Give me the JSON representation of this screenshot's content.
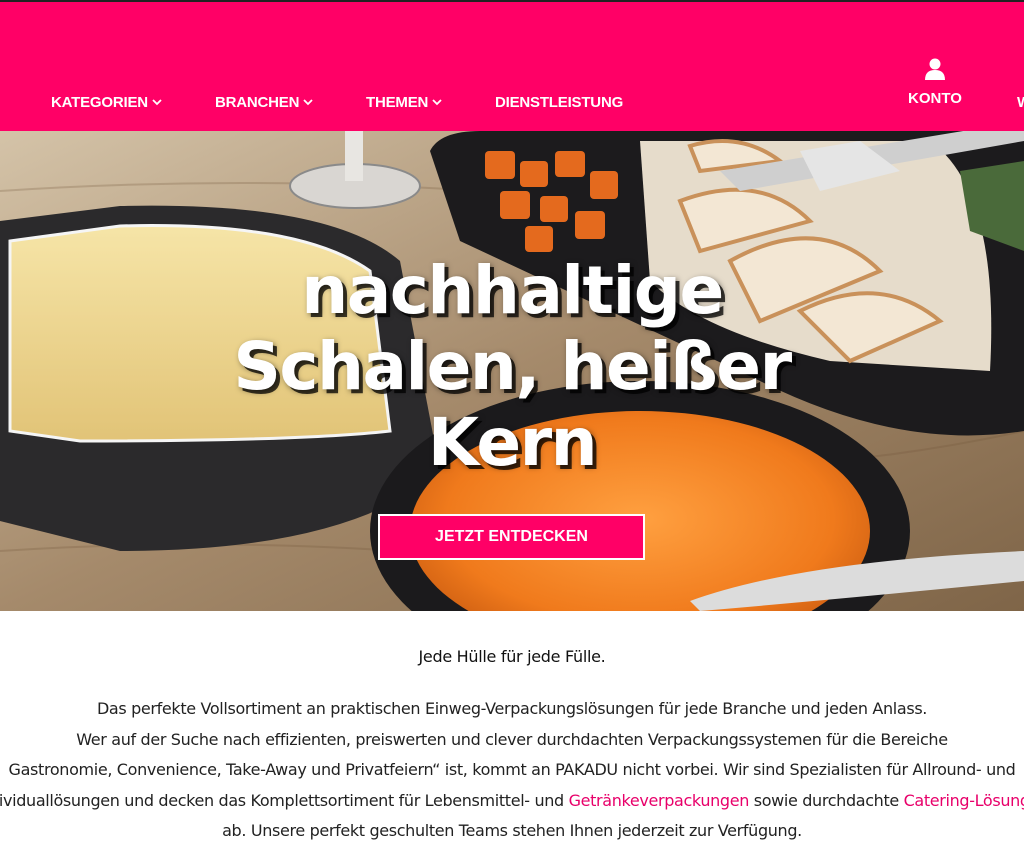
{
  "header": {
    "nav": [
      {
        "label": "KATEGORIEN",
        "has_dropdown": true
      },
      {
        "label": "BRANCHEN",
        "has_dropdown": true
      },
      {
        "label": "THEMEN",
        "has_dropdown": true
      },
      {
        "label": "DIENSTLEISTUNG",
        "has_dropdown": false
      }
    ],
    "account": {
      "label": "KONTO",
      "icon": "user-icon"
    },
    "cut_item": "W",
    "brand_color": "#ff0066"
  },
  "hero": {
    "title_lines": [
      "nachhaltige",
      "Schalen, heißer",
      "Kern"
    ],
    "cta_label": "JETZT ENTDECKEN"
  },
  "content": {
    "tagline": "Jede Hülle für jede Fülle.",
    "paragraph": {
      "line1": "Das perfekte Vollsortiment an praktischen Einweg-Verpackungslösungen für jede Branche und jeden Anlass.",
      "line2": "Wer auf der Suche nach effizienten, preiswerten und clever durchdachten Verpackungssystemen für die Bereiche",
      "line3": "Gastronomie, Convenience, Take-Away und Privatfeiern“ ist, kommt an PAKADU nicht vorbei. Wir sind Spezialisten für Allround- und",
      "line4_before": "Individuallösungen und decken das Komplettsortiment für Lebensmittel- und ",
      "link1": "Getränkeverpackungen",
      "line4_middle": " sowie durchdachte ",
      "link2": "Catering-Lösungen",
      "line5": "ab. Unsere perfekt geschulten Teams stehen Ihnen jederzeit zur Verfügung."
    },
    "link_color": "#e8006a"
  }
}
